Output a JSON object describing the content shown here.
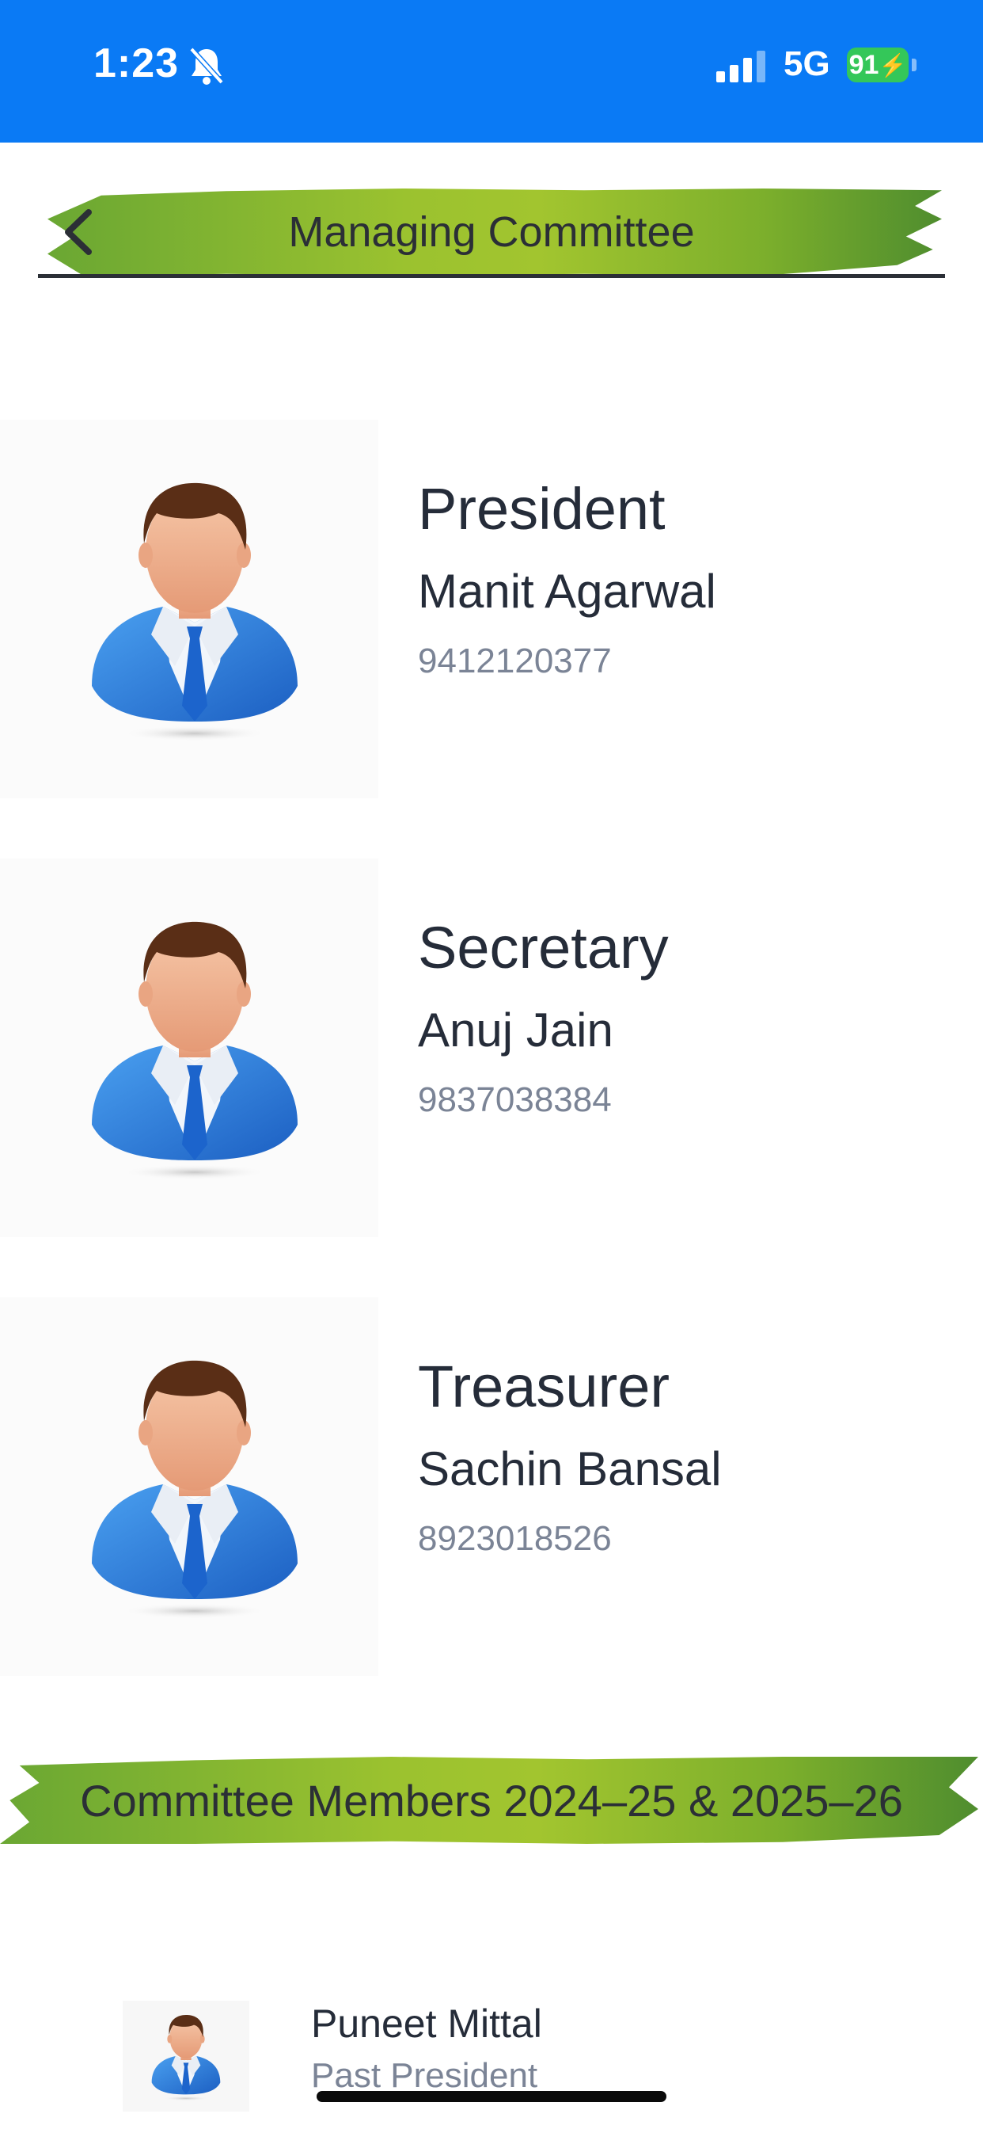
{
  "status_bar": {
    "time": "1:23",
    "network": "5G",
    "battery": "91",
    "icons": [
      "bell-slash-icon",
      "signal-icon",
      "battery-charging-icon"
    ],
    "background": "#0a7af5"
  },
  "header": {
    "title": "Managing Committee",
    "back_icon": "chevron-left-icon"
  },
  "officers": [
    {
      "role": "President",
      "name": "Manit Agarwal",
      "phone": "9412120377"
    },
    {
      "role": "Secretary",
      "name": "Anuj Jain",
      "phone": "9837038384"
    },
    {
      "role": "Treasurer",
      "name": "Sachin Bansal",
      "phone": "8923018526"
    }
  ],
  "members_section": {
    "title": "Committee Members 2024–25 & 2025–26",
    "members": [
      {
        "name": "Puneet Mittal",
        "role": "Past President"
      }
    ]
  },
  "colors": {
    "banner_green": "#9bc22f",
    "text_dark": "#252c39",
    "text_muted": "#7b8496"
  }
}
